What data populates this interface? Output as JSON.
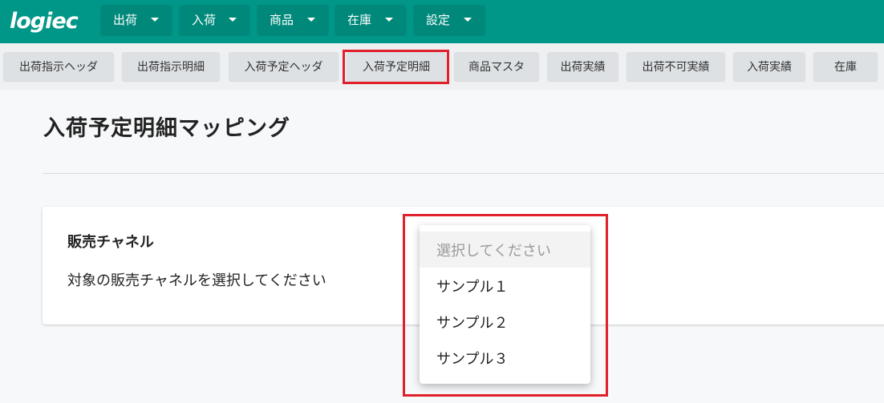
{
  "app": {
    "logo_text": "logiec"
  },
  "header": {
    "menus": [
      {
        "label": "出荷"
      },
      {
        "label": "入荷"
      },
      {
        "label": "商品"
      },
      {
        "label": "在庫"
      },
      {
        "label": "設定"
      }
    ]
  },
  "subnav": {
    "tabs": [
      {
        "label": "出荷指示ヘッダ"
      },
      {
        "label": "出荷指示明細"
      },
      {
        "label": "入荷予定ヘッダ"
      },
      {
        "label": "入荷予定明細",
        "selected": true
      },
      {
        "label": "商品マスタ"
      },
      {
        "label": "出荷実績"
      },
      {
        "label": "出荷不可実績"
      },
      {
        "label": "入荷実績"
      },
      {
        "label": "在庫"
      }
    ]
  },
  "page": {
    "title": "入荷予定明細マッピング"
  },
  "card": {
    "title": "販売チャネル",
    "description": "対象の販売チャネルを選択してください"
  },
  "dropdown": {
    "placeholder": "選択してください",
    "options": [
      {
        "label": "サンプル１"
      },
      {
        "label": "サンプル２"
      },
      {
        "label": "サンプル３"
      }
    ]
  },
  "colors": {
    "header_bg": "#009688",
    "highlight": "#e0202a"
  },
  "icons": {
    "menu_caret": "caret-down-icon"
  }
}
